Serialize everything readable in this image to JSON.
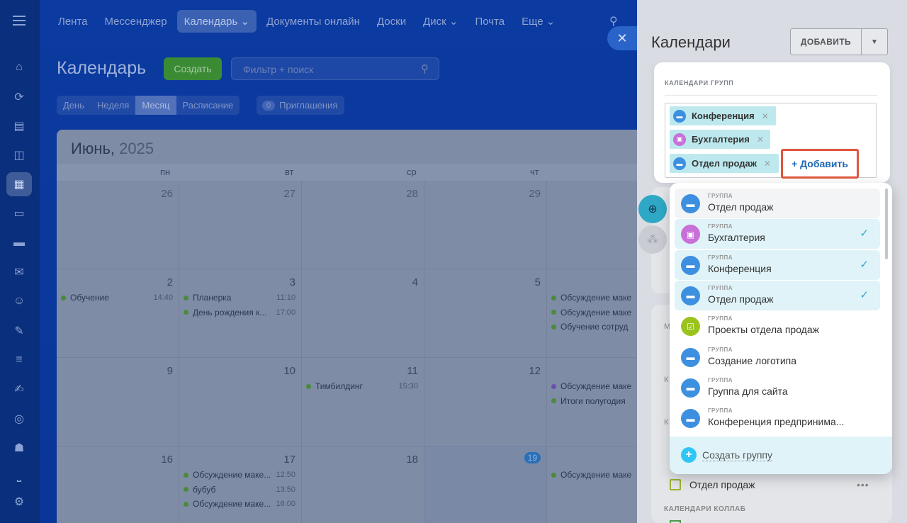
{
  "nav": {
    "items": [
      "Лента",
      "Мессенджер",
      "Календарь",
      "Документы онлайн",
      "Доски",
      "Диск",
      "Почта",
      "Еще"
    ],
    "active_index": 2
  },
  "page": {
    "title": "Календарь",
    "create_label": "Создать",
    "filter_placeholder": "Фильтр + поиск",
    "view_tabs": [
      "День",
      "Неделя",
      "Месяц",
      "Расписание"
    ],
    "active_view": "Месяц",
    "invites_count": "0",
    "invites_label": "Приглашения"
  },
  "calendar": {
    "month": "Июнь,",
    "year": "2025",
    "weekdays": [
      "пн",
      "вт",
      "ср",
      "чт"
    ],
    "weeks": [
      {
        "days": [
          {
            "d": "26",
            "prev": true,
            "events": []
          },
          {
            "d": "27",
            "prev": true,
            "events": []
          },
          {
            "d": "28",
            "prev": true,
            "events": []
          },
          {
            "d": "29",
            "prev": true,
            "events": []
          },
          {
            "d": "",
            "events": []
          }
        ]
      },
      {
        "days": [
          {
            "d": "2",
            "events": [
              {
                "t": "Обучение",
                "tm": "14:40"
              }
            ]
          },
          {
            "d": "3",
            "events": [
              {
                "t": "Планерка",
                "tm": "11:10"
              },
              {
                "t": "День рождения к...",
                "tm": "17:00"
              }
            ]
          },
          {
            "d": "4",
            "events": []
          },
          {
            "d": "5",
            "events": []
          },
          {
            "d": "",
            "events": [
              {
                "t": "Обсуждение маке",
                "tm": ""
              },
              {
                "t": "Обсуждение маке",
                "tm": ""
              },
              {
                "t": "Обучение сотруд",
                "tm": ""
              }
            ]
          }
        ]
      },
      {
        "days": [
          {
            "d": "9",
            "events": []
          },
          {
            "d": "10",
            "events": []
          },
          {
            "d": "11",
            "events": [
              {
                "t": "Тимбилдинг",
                "tm": "15:30"
              }
            ]
          },
          {
            "d": "12",
            "events": []
          },
          {
            "d": "",
            "events": [
              {
                "t": "Обсуждение маке",
                "tm": "",
                "purple": true
              },
              {
                "t": "Итоги полугодия",
                "tm": ""
              }
            ]
          }
        ]
      },
      {
        "days": [
          {
            "d": "16",
            "events": []
          },
          {
            "d": "17",
            "events": [
              {
                "t": "Обсуждение маке...",
                "tm": "12:50"
              },
              {
                "t": "бубуб",
                "tm": "13:50"
              },
              {
                "t": "Обсуждение маке...",
                "tm": "16:00"
              }
            ]
          },
          {
            "d": "18",
            "events": []
          },
          {
            "d": "19",
            "today": true,
            "events": []
          },
          {
            "d": "",
            "events": [
              {
                "t": "Обсуждение маке",
                "tm": ""
              }
            ]
          }
        ]
      }
    ]
  },
  "panel": {
    "title": "Календари",
    "add_button": "ДОБАВИТЬ",
    "group_calendars_title": "КАЛЕНДАРИ ГРУПП",
    "tags": [
      {
        "label": "Конференция",
        "color": "#3d8fe0",
        "icon": "folder-icon"
      },
      {
        "label": "Бухгалтерия",
        "color": "#c86fd8",
        "icon": "briefcase-icon"
      },
      {
        "label": "Отдел продаж",
        "color": "#3d8fe0",
        "icon": "folder-icon"
      }
    ],
    "add_link": "+ Добавить",
    "bottom_row": "Отдел продаж",
    "collab_title": "КАЛЕНДАРИ КОЛЛАБ"
  },
  "dropdown": {
    "caption": "ГРУППА",
    "items": [
      {
        "name": "Отдел продаж",
        "color": "#3d8fe0",
        "icon": "folder-icon",
        "checked": false,
        "state": "hover"
      },
      {
        "name": "Бухгалтерия",
        "color": "#c86fd8",
        "icon": "briefcase-icon",
        "checked": true,
        "state": "selected"
      },
      {
        "name": "Конференция",
        "color": "#3d8fe0",
        "icon": "folder-icon",
        "checked": true,
        "state": "selected"
      },
      {
        "name": "Отдел продаж",
        "color": "#3d8fe0",
        "icon": "folder-icon",
        "checked": true,
        "state": "selected"
      },
      {
        "name": "Проекты отдела продаж",
        "color": "#9bc31e",
        "icon": "checklist-icon",
        "checked": false,
        "state": ""
      },
      {
        "name": "Создание логотипа",
        "color": "#3d8fe0",
        "icon": "folder-icon",
        "checked": false,
        "state": ""
      },
      {
        "name": "Группа для сайта",
        "color": "#3d8fe0",
        "icon": "folder-icon",
        "checked": false,
        "state": ""
      },
      {
        "name": "Конференция предпринима...",
        "color": "#3d8fe0",
        "icon": "folder-icon",
        "checked": false,
        "state": ""
      }
    ],
    "create_group": "Создать группу"
  }
}
